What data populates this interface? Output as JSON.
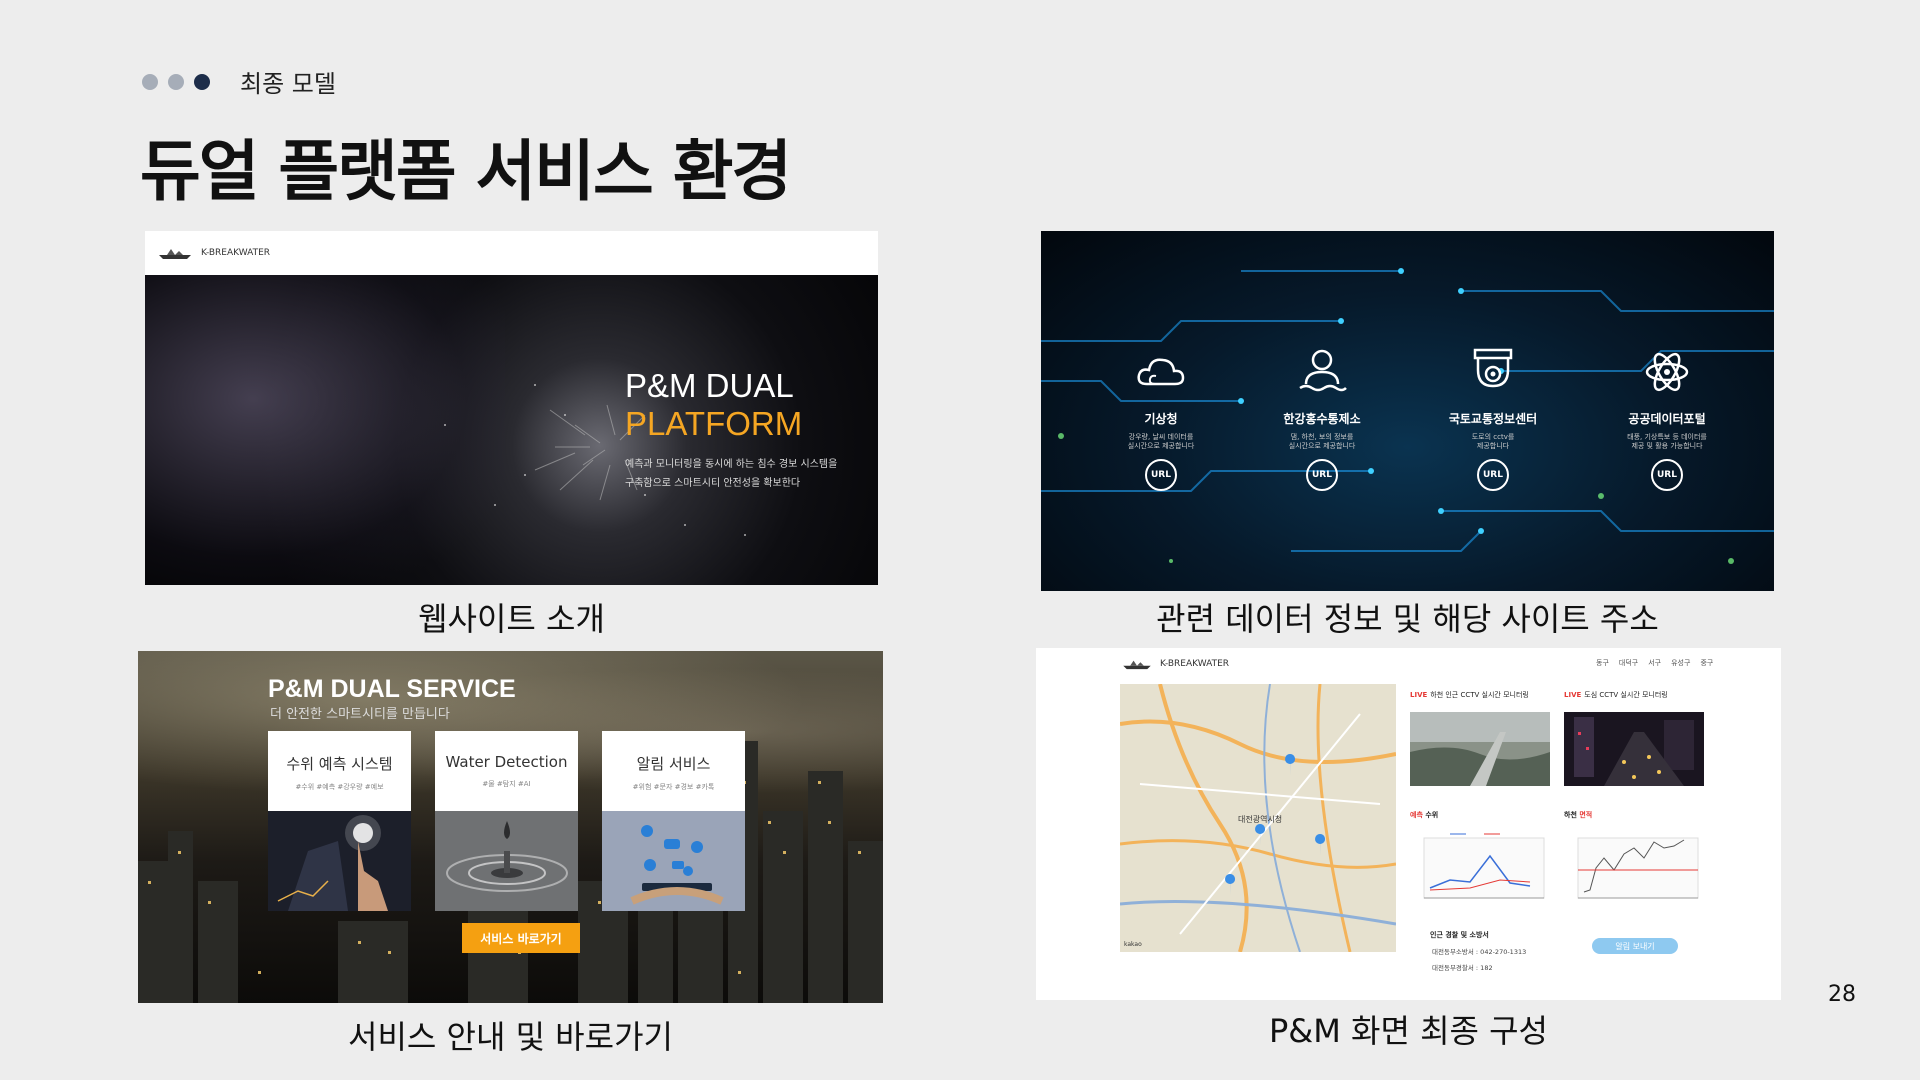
{
  "header": {
    "section_label": "최종 모델",
    "title": "듀얼 플랫폼 서비스 환경",
    "dot_colors": [
      "#a6adb8",
      "#a6adb8",
      "#1d2d4a"
    ]
  },
  "page_number": "28",
  "panels": {
    "website": {
      "caption": "웹사이트 소개",
      "logo_text": "K-BREAKWATER",
      "hero_title_line1": "P&M DUAL",
      "hero_title_line2": "PLATFORM",
      "hero_desc_line1": "예측과 모니터링을 동시에 하는 침수 경보 시스템을",
      "hero_desc_line2": "구축함으로 스마트시티 안전성을 확보한다",
      "accent": "#f5a623"
    },
    "data_sites": {
      "caption": "관련 데이터 정보 및 해당 사이트 주소",
      "sites": [
        {
          "name": "기상청",
          "desc1": "강우량, 날씨 데이터를",
          "desc2": "실시간으로 제공합니다",
          "icon": "cloud-icon",
          "url_label": "URL"
        },
        {
          "name": "한강홍수통제소",
          "desc1": "댐, 하천, 보의 정보를",
          "desc2": "실시간으로 제공합니다",
          "icon": "user-water-icon",
          "url_label": "URL"
        },
        {
          "name": "국토교통정보센터",
          "desc1": "도로의 cctv를",
          "desc2": "제공합니다",
          "icon": "cctv-camera-icon",
          "url_label": "URL"
        },
        {
          "name": "공공데이터포털",
          "desc1": "태풍, 기상특보 등 데이터를",
          "desc2": "제공 및 활용 가능합니다",
          "icon": "atom-icon",
          "url_label": "URL"
        }
      ]
    },
    "services": {
      "caption": "서비스 안내 및 바로가기",
      "title": "P&M DUAL SERVICE",
      "subtitle": "더 안전한 스마트시티를 만듭니다",
      "cards": [
        {
          "title": "수위 예측 시스템",
          "tags": "#수위 #예측 #강우량 #예보",
          "image": "touch-screen-image"
        },
        {
          "title": "Water Detection",
          "tags": "#물 #탐지 #AI",
          "image": "water-drop-image"
        },
        {
          "title": "알림 서비스",
          "tags": "#위험 #문자 #경보 #카톡",
          "image": "phone-notification-image"
        }
      ],
      "go_button": "서비스 바로가기",
      "accent": "#f5a011"
    },
    "final_screen": {
      "caption": "P&M 화면 최종 구성",
      "logo_text": "K-BREAKWATER",
      "menu": [
        "동구",
        "대덕구",
        "서구",
        "유성구",
        "중구"
      ],
      "map_label": "대전광역시청",
      "map_footer": "kakao",
      "live_label_1": "하천 인근 CCTV 실시간 모니터링",
      "live_label_2": "도심 CCTV 실시간 모니터링",
      "live_tag": "LIVE",
      "forecast_label_red": "예측",
      "forecast_label_rest": " 수위",
      "river_label_rest": "하천 ",
      "river_label_red": "면적",
      "info_title": "인근 경찰 및 소방서",
      "info_line1": "대전동부소방서 : 042-270-1313",
      "info_line2": "대전동부경찰서 : 182",
      "alarm_button": "알림 보내기"
    }
  }
}
